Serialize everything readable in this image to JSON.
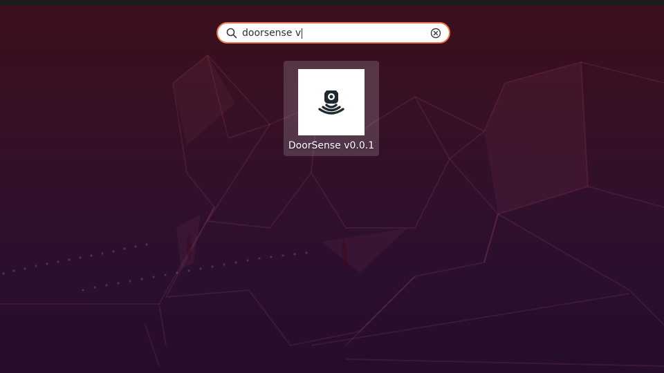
{
  "search": {
    "query": "doorsense v",
    "search_icon": "search-icon",
    "clear_icon": "clear-circle-icon"
  },
  "results": [
    {
      "label": "DoorSense v0.0.1",
      "icon": "doorsense-sensor-icon"
    }
  ],
  "colors": {
    "accent": "#e9764c",
    "background_top": "#3c0f1b",
    "background_bottom": "#260d2b",
    "tile_highlight": "rgba(255,255,255,0.16)"
  }
}
